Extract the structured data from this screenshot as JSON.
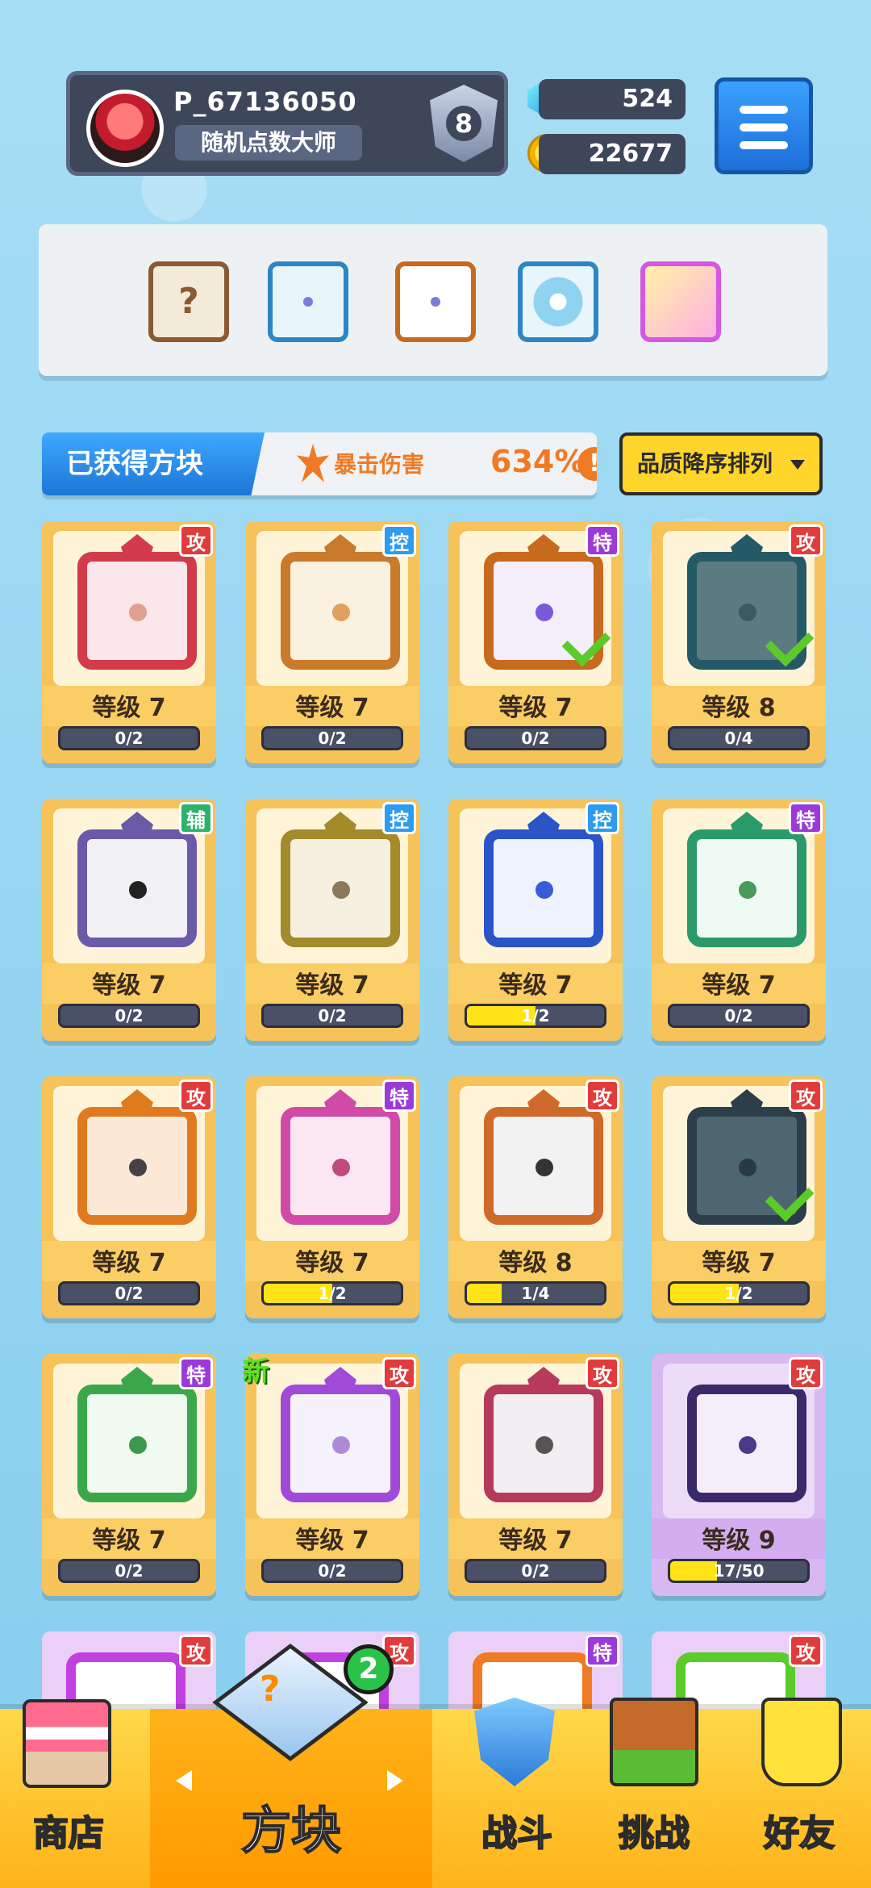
{
  "player": {
    "name": "P_67136050",
    "title": "随机点数大师",
    "rank": "8"
  },
  "currency": {
    "gems": "524",
    "coins": "22677"
  },
  "deck": [
    {
      "name": "mystery",
      "symbol": "?"
    },
    {
      "name": "ice-dragon"
    },
    {
      "name": "rainbow-dragon"
    },
    {
      "name": "swirl-dragon"
    },
    {
      "name": "flower"
    }
  ],
  "section": {
    "title": "已获得方块",
    "crit_label": "暴击伤害",
    "crit_value": "634%",
    "info": "!"
  },
  "sort": {
    "label": "品质降序排列"
  },
  "badge_labels": {
    "atk": "攻",
    "ctl": "控",
    "spc": "特",
    "sup": "辅"
  },
  "cards": [
    {
      "type": "atk",
      "level": "等级 7",
      "progress": "0/2",
      "fill": 0,
      "color": "#d33a4a",
      "bg": "#fbe7ea",
      "dot": "#e0a090",
      "check": false
    },
    {
      "type": "ctl",
      "level": "等级 7",
      "progress": "0/2",
      "fill": 0,
      "color": "#c97a2a",
      "bg": "#fbf1e1",
      "dot": "#e0a060",
      "check": false
    },
    {
      "type": "spc",
      "level": "等级 7",
      "progress": "0/2",
      "fill": 0,
      "color": "#c76a1e",
      "bg": "#f4eefa",
      "dot": "#7a5ad8",
      "check": true
    },
    {
      "type": "atk",
      "level": "等级 8",
      "progress": "0/4",
      "fill": 0,
      "color": "#245a66",
      "bg": "#5c7a80",
      "dot": "#3b5b60",
      "check": true
    },
    {
      "type": "sup",
      "level": "等级 7",
      "progress": "0/2",
      "fill": 0,
      "color": "#6b5aa8",
      "bg": "#f1f0f5",
      "dot": "#222",
      "check": false
    },
    {
      "type": "ctl",
      "level": "等级 7",
      "progress": "0/2",
      "fill": 0,
      "color": "#a38a2a",
      "bg": "#f5f0e0",
      "dot": "#8a7a5a",
      "check": false
    },
    {
      "type": "ctl",
      "level": "等级 7",
      "progress": "1/2",
      "fill": 0.5,
      "color": "#2a54c8",
      "bg": "#eef3ff",
      "dot": "#3a5ad8",
      "check": false
    },
    {
      "type": "spc",
      "level": "等级 7",
      "progress": "0/2",
      "fill": 0,
      "color": "#2a9a6a",
      "bg": "#effaf3",
      "dot": "#4a9a5a",
      "check": false
    },
    {
      "type": "atk",
      "level": "等级 7",
      "progress": "0/2",
      "fill": 0,
      "color": "#e07a1e",
      "bg": "#fbe9d6",
      "dot": "#444",
      "check": false
    },
    {
      "type": "spc",
      "level": "等级 7",
      "progress": "1/2",
      "fill": 0.5,
      "color": "#d24aa8",
      "bg": "#fbe7f2",
      "dot": "#c04a7a",
      "check": false
    },
    {
      "type": "atk",
      "level": "等级 8",
      "progress": "1/4",
      "fill": 0.25,
      "color": "#d06a2a",
      "bg": "#f2f2f2",
      "dot": "#333",
      "check": false
    },
    {
      "type": "atk",
      "level": "等级 7",
      "progress": "1/2",
      "fill": 0.5,
      "color": "#2b3e4a",
      "bg": "#4e6670",
      "dot": "#2a3a42",
      "check": true
    },
    {
      "type": "spc",
      "level": "等级 7",
      "progress": "0/2",
      "fill": 0,
      "color": "#3aa84a",
      "bg": "#f0faf0",
      "dot": "#3a9a4a",
      "check": false
    },
    {
      "type": "atk",
      "level": "等级 7",
      "progress": "0/2",
      "fill": 0,
      "color": "#a04ad8",
      "bg": "#f5f2fb",
      "dot": "#b08ad8",
      "check": false
    },
    {
      "type": "atk",
      "level": "等级 7",
      "progress": "0/2",
      "fill": 0,
      "color": "#b83a5a",
      "bg": "#f2eef2",
      "dot": "#555",
      "check": false
    },
    {
      "type": "atk",
      "level": "等级 9",
      "progress": "17/50",
      "fill": 0.34,
      "color": "#3b2a6a",
      "bg": "#f4eefa",
      "dot": "#4a3a8a",
      "check": false,
      "epic": true
    }
  ],
  "new_tag": "新",
  "peek": [
    {
      "type": "atk",
      "color": "#c040e0"
    },
    {
      "type": "atk",
      "color": "#c040e0"
    },
    {
      "type": "spc",
      "color": "#f07a24"
    },
    {
      "type": "atk",
      "color": "#5acb2b"
    }
  ],
  "nav": {
    "items": [
      {
        "label": "商店"
      },
      {
        "label": "方块",
        "active": true,
        "badge": "2"
      },
      {
        "label": "战斗"
      },
      {
        "label": "挑战"
      },
      {
        "label": "好友"
      }
    ]
  }
}
